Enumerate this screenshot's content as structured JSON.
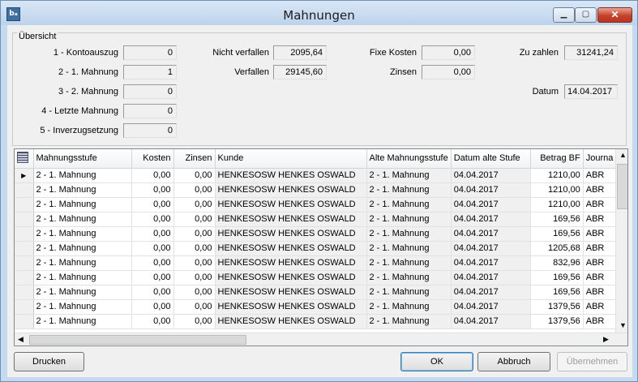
{
  "window": {
    "title": "Mahnungen",
    "icon": "app-icon",
    "icon_text": "bₐ"
  },
  "summary": {
    "group_label": "Übersicht",
    "levels": [
      {
        "label": "1 - Kontoauszug",
        "value": "0"
      },
      {
        "label": "2 - 1. Mahnung",
        "value": "1"
      },
      {
        "label": "3 - 2. Mahnung",
        "value": "0"
      },
      {
        "label": "4 - Letzte Mahnung",
        "value": "0"
      },
      {
        "label": "5 - Inverzugsetzung",
        "value": "0"
      }
    ],
    "nicht_verfallen": {
      "label": "Nicht verfallen",
      "value": "2095,64"
    },
    "verfallen": {
      "label": "Verfallen",
      "value": "29145,60"
    },
    "fixe_kosten": {
      "label": "Fixe Kosten",
      "value": "0,00"
    },
    "zinsen": {
      "label": "Zinsen",
      "value": "0,00"
    },
    "zu_zahlen": {
      "label": "Zu zahlen",
      "value": "31241,24"
    },
    "datum": {
      "label": "Datum",
      "value": "14.04.2017"
    }
  },
  "grid": {
    "columns": [
      "Mahnungsstufe",
      "Kosten",
      "Zinsen",
      "Kunde",
      "Alte Mahnungsstufe",
      "Datum alte Stufe",
      "Betrag BF",
      "Journa"
    ],
    "rows": [
      [
        "2 - 1. Mahnung",
        "0,00",
        "0,00",
        "HENKESOSW   HENKES OSWALD",
        "2 - 1. Mahnung",
        "04.04.2017",
        "1210,00",
        "ABR"
      ],
      [
        "2 - 1. Mahnung",
        "0,00",
        "0,00",
        "HENKESOSW   HENKES OSWALD",
        "2 - 1. Mahnung",
        "04.04.2017",
        "1210,00",
        "ABR"
      ],
      [
        "2 - 1. Mahnung",
        "0,00",
        "0,00",
        "HENKESOSW   HENKES OSWALD",
        "2 - 1. Mahnung",
        "04.04.2017",
        "1210,00",
        "ABR"
      ],
      [
        "2 - 1. Mahnung",
        "0,00",
        "0,00",
        "HENKESOSW   HENKES OSWALD",
        "2 - 1. Mahnung",
        "04.04.2017",
        "169,56",
        "ABR"
      ],
      [
        "2 - 1. Mahnung",
        "0,00",
        "0,00",
        "HENKESOSW   HENKES OSWALD",
        "2 - 1. Mahnung",
        "04.04.2017",
        "169,56",
        "ABR"
      ],
      [
        "2 - 1. Mahnung",
        "0,00",
        "0,00",
        "HENKESOSW   HENKES OSWALD",
        "2 - 1. Mahnung",
        "04.04.2017",
        "1205,68",
        "ABR"
      ],
      [
        "2 - 1. Mahnung",
        "0,00",
        "0,00",
        "HENKESOSW   HENKES OSWALD",
        "2 - 1. Mahnung",
        "04.04.2017",
        "832,96",
        "ABR"
      ],
      [
        "2 - 1. Mahnung",
        "0,00",
        "0,00",
        "HENKESOSW   HENKES OSWALD",
        "2 - 1. Mahnung",
        "04.04.2017",
        "169,56",
        "ABR"
      ],
      [
        "2 - 1. Mahnung",
        "0,00",
        "0,00",
        "HENKESOSW   HENKES OSWALD",
        "2 - 1. Mahnung",
        "04.04.2017",
        "169,56",
        "ABR"
      ],
      [
        "2 - 1. Mahnung",
        "0,00",
        "0,00",
        "HENKESOSW   HENKES OSWALD",
        "2 - 1. Mahnung",
        "04.04.2017",
        "1379,56",
        "ABR"
      ],
      [
        "2 - 1. Mahnung",
        "0,00",
        "0,00",
        "HENKESOSW   HENKES OSWALD",
        "2 - 1. Mahnung",
        "04.04.2017",
        "1379,56",
        "ABR"
      ]
    ],
    "selected_row": 0
  },
  "buttons": {
    "print": "Drucken",
    "ok": "OK",
    "cancel": "Abbruch",
    "apply": "Übernehmen"
  }
}
